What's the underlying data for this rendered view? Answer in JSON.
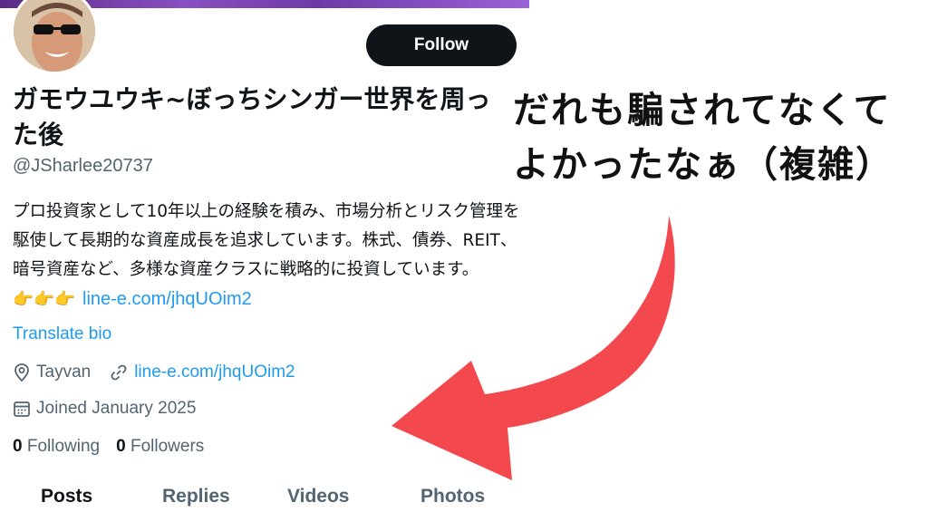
{
  "profile": {
    "follow_label": "Follow",
    "display_name": "ガモウユウキ~ぼっちシンガー世界を周った後",
    "handle": "@JSharlee20737",
    "bio_text": "プロ投資家として10年以上の経験を積み、市場分析とリスク管理を駆使して長期的な資産成長を追求しています。株式、債券、REIT、暗号資産など、多様な資産クラスに戦略的に投資しています。",
    "bio_emojis": "👉👉👉",
    "bio_link": "line-e.com/jhqUOim2",
    "translate_label": "Translate bio",
    "location": "Tayvan",
    "website": "line-e.com/jhqUOim2",
    "joined": "Joined January 2025",
    "following_count": "0",
    "following_label": "Following",
    "followers_count": "0",
    "followers_label": "Followers"
  },
  "tabs": [
    "Posts",
    "Replies",
    "Videos",
    "Photos"
  ],
  "caption": {
    "line1": "だれも騙されてなくて",
    "line2": "よかったなぁ（複雑）"
  },
  "colors": {
    "link": "#1d9bf0",
    "muted": "#536471",
    "arrow": "#f4484f",
    "button": "#0f1419"
  },
  "icons": [
    "location-pin-icon",
    "link-icon",
    "calendar-icon",
    "curved-arrow-icon"
  ]
}
